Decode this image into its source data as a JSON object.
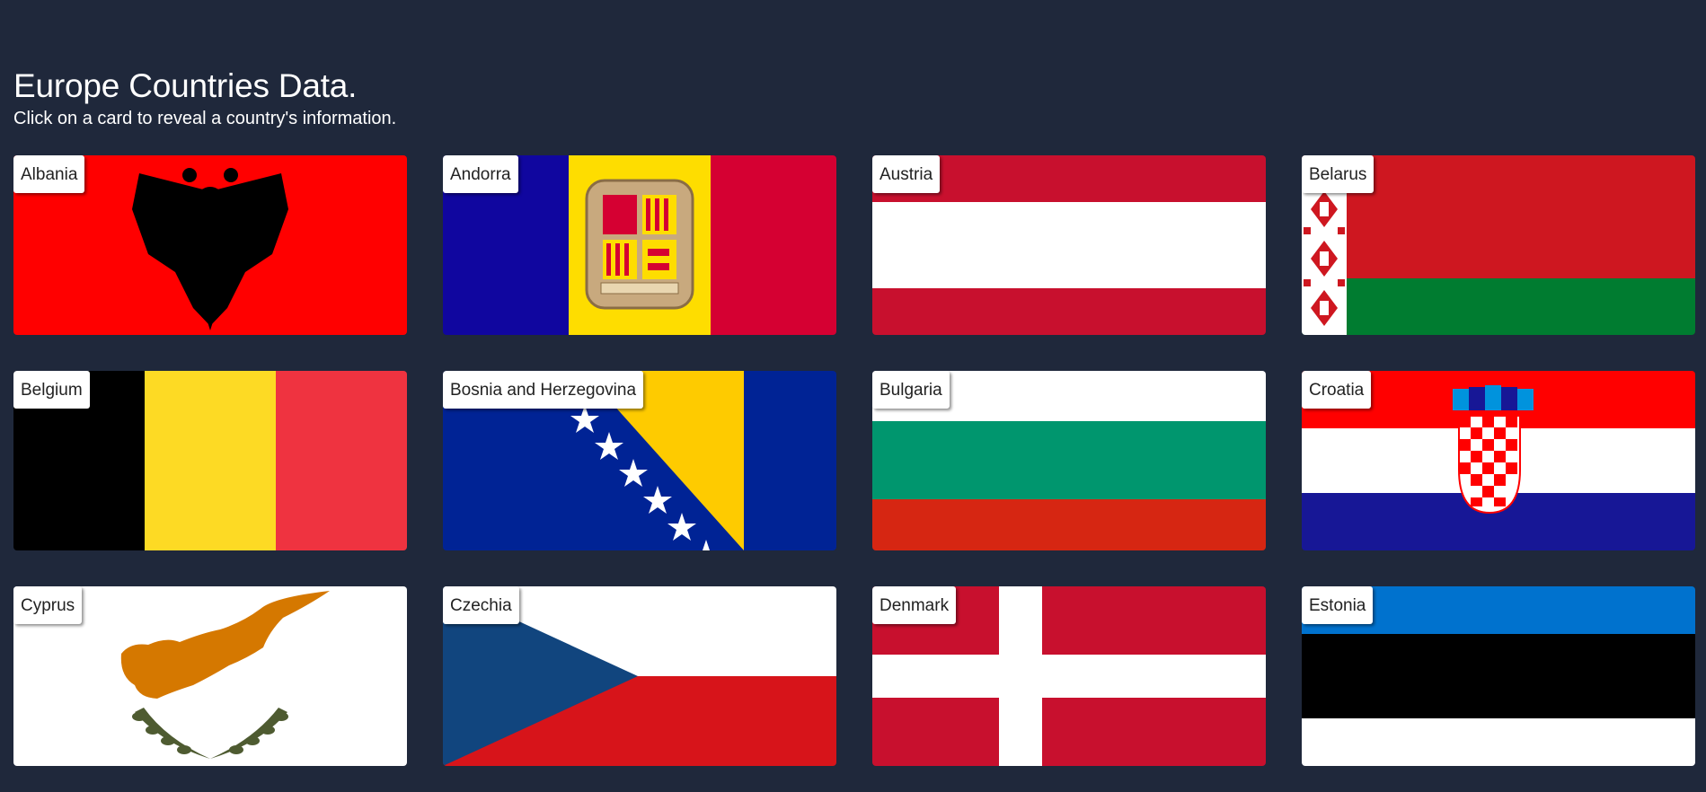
{
  "page": {
    "title": "Europe Countries Data.",
    "subtitle": "Click on a card to reveal a country's information."
  },
  "cards": [
    {
      "name": "Albania",
      "flag": "albania-flag"
    },
    {
      "name": "Andorra",
      "flag": "andorra-flag"
    },
    {
      "name": "Austria",
      "flag": "austria-flag"
    },
    {
      "name": "Belarus",
      "flag": "belarus-flag"
    },
    {
      "name": "Belgium",
      "flag": "belgium-flag"
    },
    {
      "name": "Bosnia and Herzegovina",
      "flag": "bosnia-and-herzegovina-flag"
    },
    {
      "name": "Bulgaria",
      "flag": "bulgaria-flag"
    },
    {
      "name": "Croatia",
      "flag": "croatia-flag"
    },
    {
      "name": "Cyprus",
      "flag": "cyprus-flag"
    },
    {
      "name": "Czechia",
      "flag": "czechia-flag"
    },
    {
      "name": "Denmark",
      "flag": "denmark-flag"
    },
    {
      "name": "Estonia",
      "flag": "estonia-flag"
    }
  ],
  "colors": {
    "background": "#1f283b",
    "label_bg": "#ffffff",
    "label_text": "#222222"
  }
}
